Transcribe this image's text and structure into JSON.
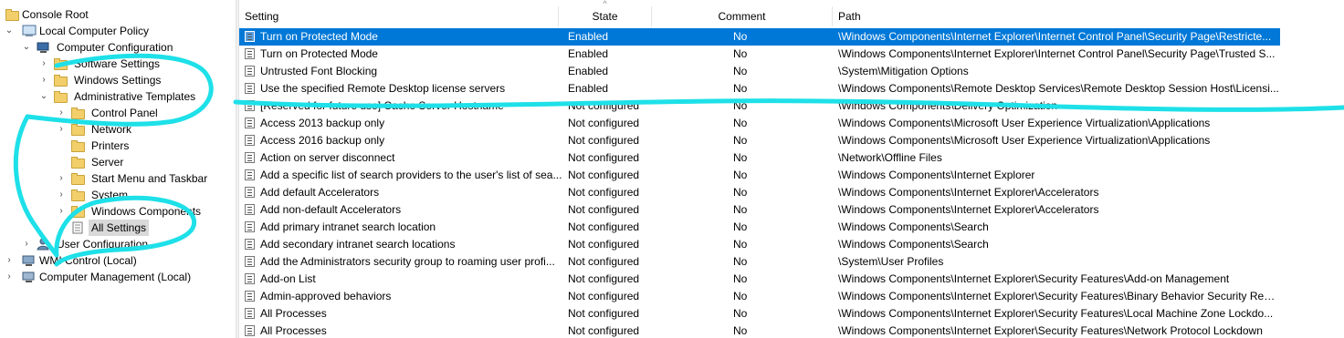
{
  "tree": {
    "items": [
      {
        "label": "Console Root",
        "twisty": "",
        "icon": "folder-icon"
      },
      {
        "label": "Local Computer Policy",
        "twisty": "⌄",
        "icon": "policy-icon"
      },
      {
        "label": "Computer Configuration",
        "twisty": "⌄",
        "icon": "computer-icon"
      },
      {
        "label": "Software Settings",
        "twisty": "›",
        "icon": "folder-icon"
      },
      {
        "label": "Windows Settings",
        "twisty": "›",
        "icon": "folder-icon"
      },
      {
        "label": "Administrative Templates",
        "twisty": "⌄",
        "icon": "folder-icon"
      },
      {
        "label": "Control Panel",
        "twisty": "›",
        "icon": "folder-icon"
      },
      {
        "label": "Network",
        "twisty": "›",
        "icon": "folder-icon"
      },
      {
        "label": "Printers",
        "twisty": "",
        "icon": "folder-icon"
      },
      {
        "label": "Server",
        "twisty": "",
        "icon": "folder-icon"
      },
      {
        "label": "Start Menu and Taskbar",
        "twisty": "›",
        "icon": "folder-icon"
      },
      {
        "label": "System",
        "twisty": "›",
        "icon": "folder-icon"
      },
      {
        "label": "Windows Components",
        "twisty": "›",
        "icon": "folder-icon"
      },
      {
        "label": "All Settings",
        "twisty": "",
        "icon": "settings-icon"
      },
      {
        "label": "User Configuration",
        "twisty": "›",
        "icon": "user-icon"
      },
      {
        "label": "WMI Control (Local)",
        "twisty": "›",
        "icon": "wmi-icon"
      },
      {
        "label": "Computer Management (Local)",
        "twisty": "›",
        "icon": "computer-icon"
      }
    ]
  },
  "table": {
    "columns": {
      "setting": "Setting",
      "state": "State",
      "comment": "Comment",
      "path": "Path"
    },
    "sort_indicator": "^",
    "rows": [
      {
        "setting": "Turn on Protected Mode",
        "state": "Enabled",
        "comment": "No",
        "path": "\\Windows Components\\Internet Explorer\\Internet Control Panel\\Security Page\\Restricte..."
      },
      {
        "setting": "Turn on Protected Mode",
        "state": "Enabled",
        "comment": "No",
        "path": "\\Windows Components\\Internet Explorer\\Internet Control Panel\\Security Page\\Trusted S..."
      },
      {
        "setting": "Untrusted Font Blocking",
        "state": "Enabled",
        "comment": "No",
        "path": "\\System\\Mitigation Options"
      },
      {
        "setting": "Use the specified Remote Desktop license servers",
        "state": "Enabled",
        "comment": "No",
        "path": "\\Windows Components\\Remote Desktop Services\\Remote Desktop Session Host\\Licensi..."
      },
      {
        "setting": "[Reserved for future use] Cache Server Hostname",
        "state": "Not configured",
        "comment": "No",
        "path": "\\Windows Components\\Delivery Optimization"
      },
      {
        "setting": "Access 2013 backup only",
        "state": "Not configured",
        "comment": "No",
        "path": "\\Windows Components\\Microsoft User Experience Virtualization\\Applications"
      },
      {
        "setting": "Access 2016 backup only",
        "state": "Not configured",
        "comment": "No",
        "path": "\\Windows Components\\Microsoft User Experience Virtualization\\Applications"
      },
      {
        "setting": "Action on server disconnect",
        "state": "Not configured",
        "comment": "No",
        "path": "\\Network\\Offline Files"
      },
      {
        "setting": "Add a specific list of search providers to the user's list of sea...",
        "state": "Not configured",
        "comment": "No",
        "path": "\\Windows Components\\Internet Explorer"
      },
      {
        "setting": "Add default Accelerators",
        "state": "Not configured",
        "comment": "No",
        "path": "\\Windows Components\\Internet Explorer\\Accelerators"
      },
      {
        "setting": "Add non-default Accelerators",
        "state": "Not configured",
        "comment": "No",
        "path": "\\Windows Components\\Internet Explorer\\Accelerators"
      },
      {
        "setting": "Add primary intranet search location",
        "state": "Not configured",
        "comment": "No",
        "path": "\\Windows Components\\Search"
      },
      {
        "setting": "Add secondary intranet search locations",
        "state": "Not configured",
        "comment": "No",
        "path": "\\Windows Components\\Search"
      },
      {
        "setting": "Add the Administrators security group to roaming user profi...",
        "state": "Not configured",
        "comment": "No",
        "path": "\\System\\User Profiles"
      },
      {
        "setting": "Add-on List",
        "state": "Not configured",
        "comment": "No",
        "path": "\\Windows Components\\Internet Explorer\\Security Features\\Add-on Management"
      },
      {
        "setting": "Admin-approved behaviors",
        "state": "Not configured",
        "comment": "No",
        "path": "\\Windows Components\\Internet Explorer\\Security Features\\Binary Behavior Security Rest..."
      },
      {
        "setting": "All Processes",
        "state": "Not configured",
        "comment": "No",
        "path": "\\Windows Components\\Internet Explorer\\Security Features\\Local Machine Zone Lockdo..."
      },
      {
        "setting": "All Processes",
        "state": "Not configured",
        "comment": "No",
        "path": "\\Windows Components\\Internet Explorer\\Security Features\\Network Protocol Lockdown"
      }
    ]
  },
  "colors": {
    "selection": "#0078d7",
    "annotation": "#1ee0e8"
  }
}
